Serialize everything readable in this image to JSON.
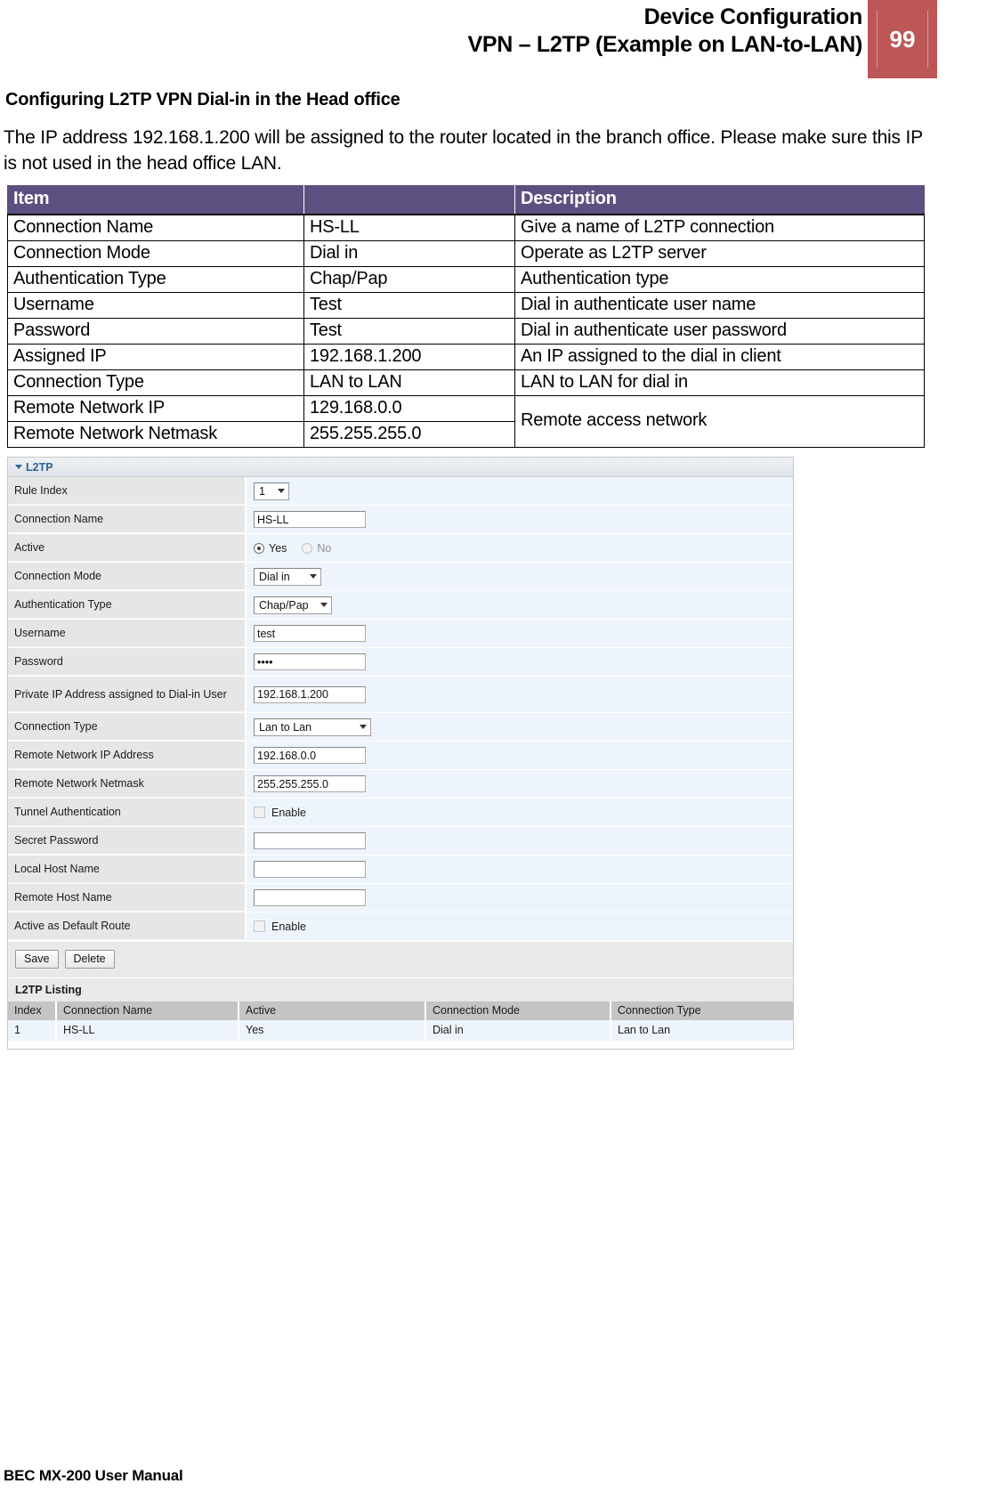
{
  "header": {
    "title_line1": "Device Configuration",
    "title_line2": "VPN – L2TP (Example on LAN-to-LAN)",
    "page_number": "99",
    "badge_color": "#bd5757"
  },
  "content": {
    "section_heading": "Configuring L2TP VPN Dial-in in the Head office",
    "intro_paragraph": "The IP address 192.168.1.200 will be assigned to the router located in the branch office. Please make sure this IP is not used in the head office LAN."
  },
  "spec_table": {
    "header_color": "#5d5080",
    "columns": [
      "Item",
      "",
      "Description"
    ],
    "rows": [
      {
        "item": "Connection Name",
        "value": "HS-LL",
        "desc": "Give a name of L2TP connection"
      },
      {
        "item": "Connection Mode",
        "value": "Dial in",
        "desc": "Operate as L2TP server"
      },
      {
        "item": "Authentication Type",
        "value": "Chap/Pap",
        "desc": "Authentication type"
      },
      {
        "item": "Username",
        "value": "Test",
        "desc": "Dial in authenticate user name"
      },
      {
        "item": "Password",
        "value": "Test",
        "desc": "Dial in authenticate user password"
      },
      {
        "item": "Assigned IP",
        "value": "192.168.1.200",
        "desc": "An IP assigned to the dial in client"
      },
      {
        "item": "Connection Type",
        "value": "LAN to LAN",
        "desc": "LAN to LAN for dial in"
      },
      {
        "item": "Remote Network IP",
        "value": "129.168.0.0",
        "desc": "Remote access network"
      },
      {
        "item": "Remote Network Netmask",
        "value": "255.255.255.0",
        "desc": ""
      }
    ]
  },
  "ui_panel": {
    "panel_title": "L2TP",
    "accent_color": "#2a6496",
    "fields": {
      "rule_index_label": "Rule Index",
      "rule_index_value": "1",
      "connection_name_label": "Connection Name",
      "connection_name_value": "HS-LL",
      "active_label": "Active",
      "active_yes": "Yes",
      "active_no": "No",
      "connection_mode_label": "Connection Mode",
      "connection_mode_value": "Dial in",
      "auth_type_label": "Authentication Type",
      "auth_type_value": "Chap/Pap",
      "username_label": "Username",
      "username_value": "test",
      "password_label": "Password",
      "password_value": "••••",
      "private_ip_label": "Private IP Address assigned to Dial-in User",
      "private_ip_value": "192.168.1.200",
      "connection_type_label": "Connection Type",
      "connection_type_value": "Lan to Lan",
      "remote_ip_label": "Remote Network IP Address",
      "remote_ip_value": "192.168.0.0",
      "remote_netmask_label": "Remote Network Netmask",
      "remote_netmask_value": "255.255.255.0",
      "tunnel_auth_label": "Tunnel Authentication",
      "tunnel_auth_enable": "Enable",
      "secret_password_label": "Secret Password",
      "secret_password_value": "",
      "local_host_label": "Local Host Name",
      "local_host_value": "",
      "remote_host_label": "Remote Host Name",
      "remote_host_value": "",
      "default_route_label": "Active as Default Route",
      "default_route_enable": "Enable"
    },
    "buttons": {
      "save": "Save",
      "delete": "Delete"
    },
    "listing": {
      "title": "L2TP Listing",
      "columns": [
        "Index",
        "Connection Name",
        "Active",
        "Connection Mode",
        "Connection Type"
      ],
      "rows": [
        {
          "index": "1",
          "name": "HS-LL",
          "active": "Yes",
          "mode": "Dial in",
          "type": "Lan to Lan"
        }
      ]
    }
  },
  "footer": {
    "text": "BEC MX-200 User Manual"
  }
}
